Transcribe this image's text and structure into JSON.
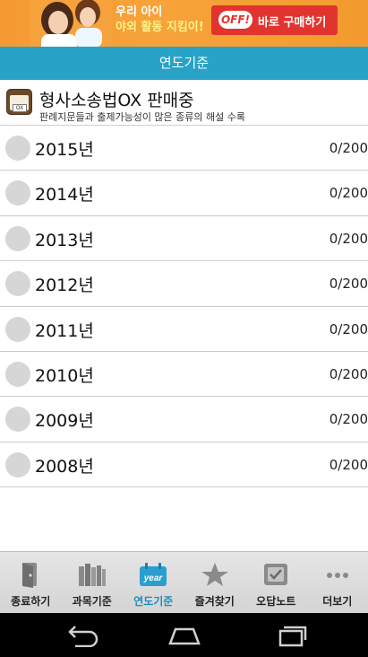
{
  "ad": {
    "line1": "우리 아이",
    "line2": "야외 활동 지킴이!",
    "off_logo": "OFF!",
    "buy_label": "바로 구매하기"
  },
  "title_bar": {
    "title": "연도기준"
  },
  "promo": {
    "title": "형사소송법OX 판매중",
    "subtitle": "판례지문들과 출제가능성이 많은 종류의 해설 수록",
    "icon_caption": "OX"
  },
  "years": [
    {
      "label": "2015년",
      "count": "0/200"
    },
    {
      "label": "2014년",
      "count": "0/200"
    },
    {
      "label": "2013년",
      "count": "0/200"
    },
    {
      "label": "2012년",
      "count": "0/200"
    },
    {
      "label": "2011년",
      "count": "0/200"
    },
    {
      "label": "2010년",
      "count": "0/200"
    },
    {
      "label": "2009년",
      "count": "0/200"
    },
    {
      "label": "2008년",
      "count": "0/200"
    }
  ],
  "bottom_nav": [
    {
      "label": "종료하기",
      "icon": "exit-door-icon"
    },
    {
      "label": "과목기준",
      "icon": "books-icon"
    },
    {
      "label": "연도기준",
      "icon": "year-calendar-icon",
      "active": true
    },
    {
      "label": "즐겨찾기",
      "icon": "star-icon"
    },
    {
      "label": "오답노트",
      "icon": "note-check-icon"
    },
    {
      "label": "더보기",
      "icon": "more-dots-icon"
    }
  ],
  "colors": {
    "accent": "#28a2c7",
    "active_nav": "#1a8fbf",
    "ad_orange": "#f59a32",
    "ad_button": "#e2342e"
  }
}
